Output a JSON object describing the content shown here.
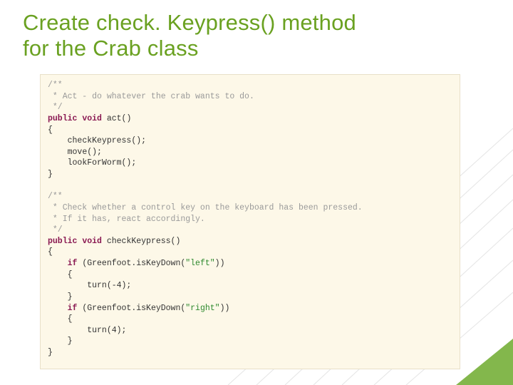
{
  "slide": {
    "title_line1": "Create check. Keypress() method",
    "title_line2": "for the Crab class"
  },
  "code": {
    "c1": "/**",
    "c2": " * Act - do whatever the crab wants to do.",
    "c3": " */",
    "kw_public": "public",
    "kw_void": "void",
    "fn_act": "act()",
    "lbrace": "{",
    "rbrace": "}",
    "call1": "checkKeypress();",
    "call2": "move();",
    "call3": "lookForWorm();",
    "c4": "/**",
    "c5": " * Check whether a control key on the keyboard has been pressed.",
    "c6": " * If it has, react accordingly.",
    "c7": " */",
    "fn_ck": "checkKeypress()",
    "kw_if": "if",
    "gf_left_a": " (Greenfoot.isKeyDown(",
    "str_left": "\"left\"",
    "gf_close": "))",
    "turn_neg": "turn(-4);",
    "gf_right_a": " (Greenfoot.isKeyDown(",
    "str_right": "\"right\"",
    "turn_pos": "turn(4);"
  }
}
